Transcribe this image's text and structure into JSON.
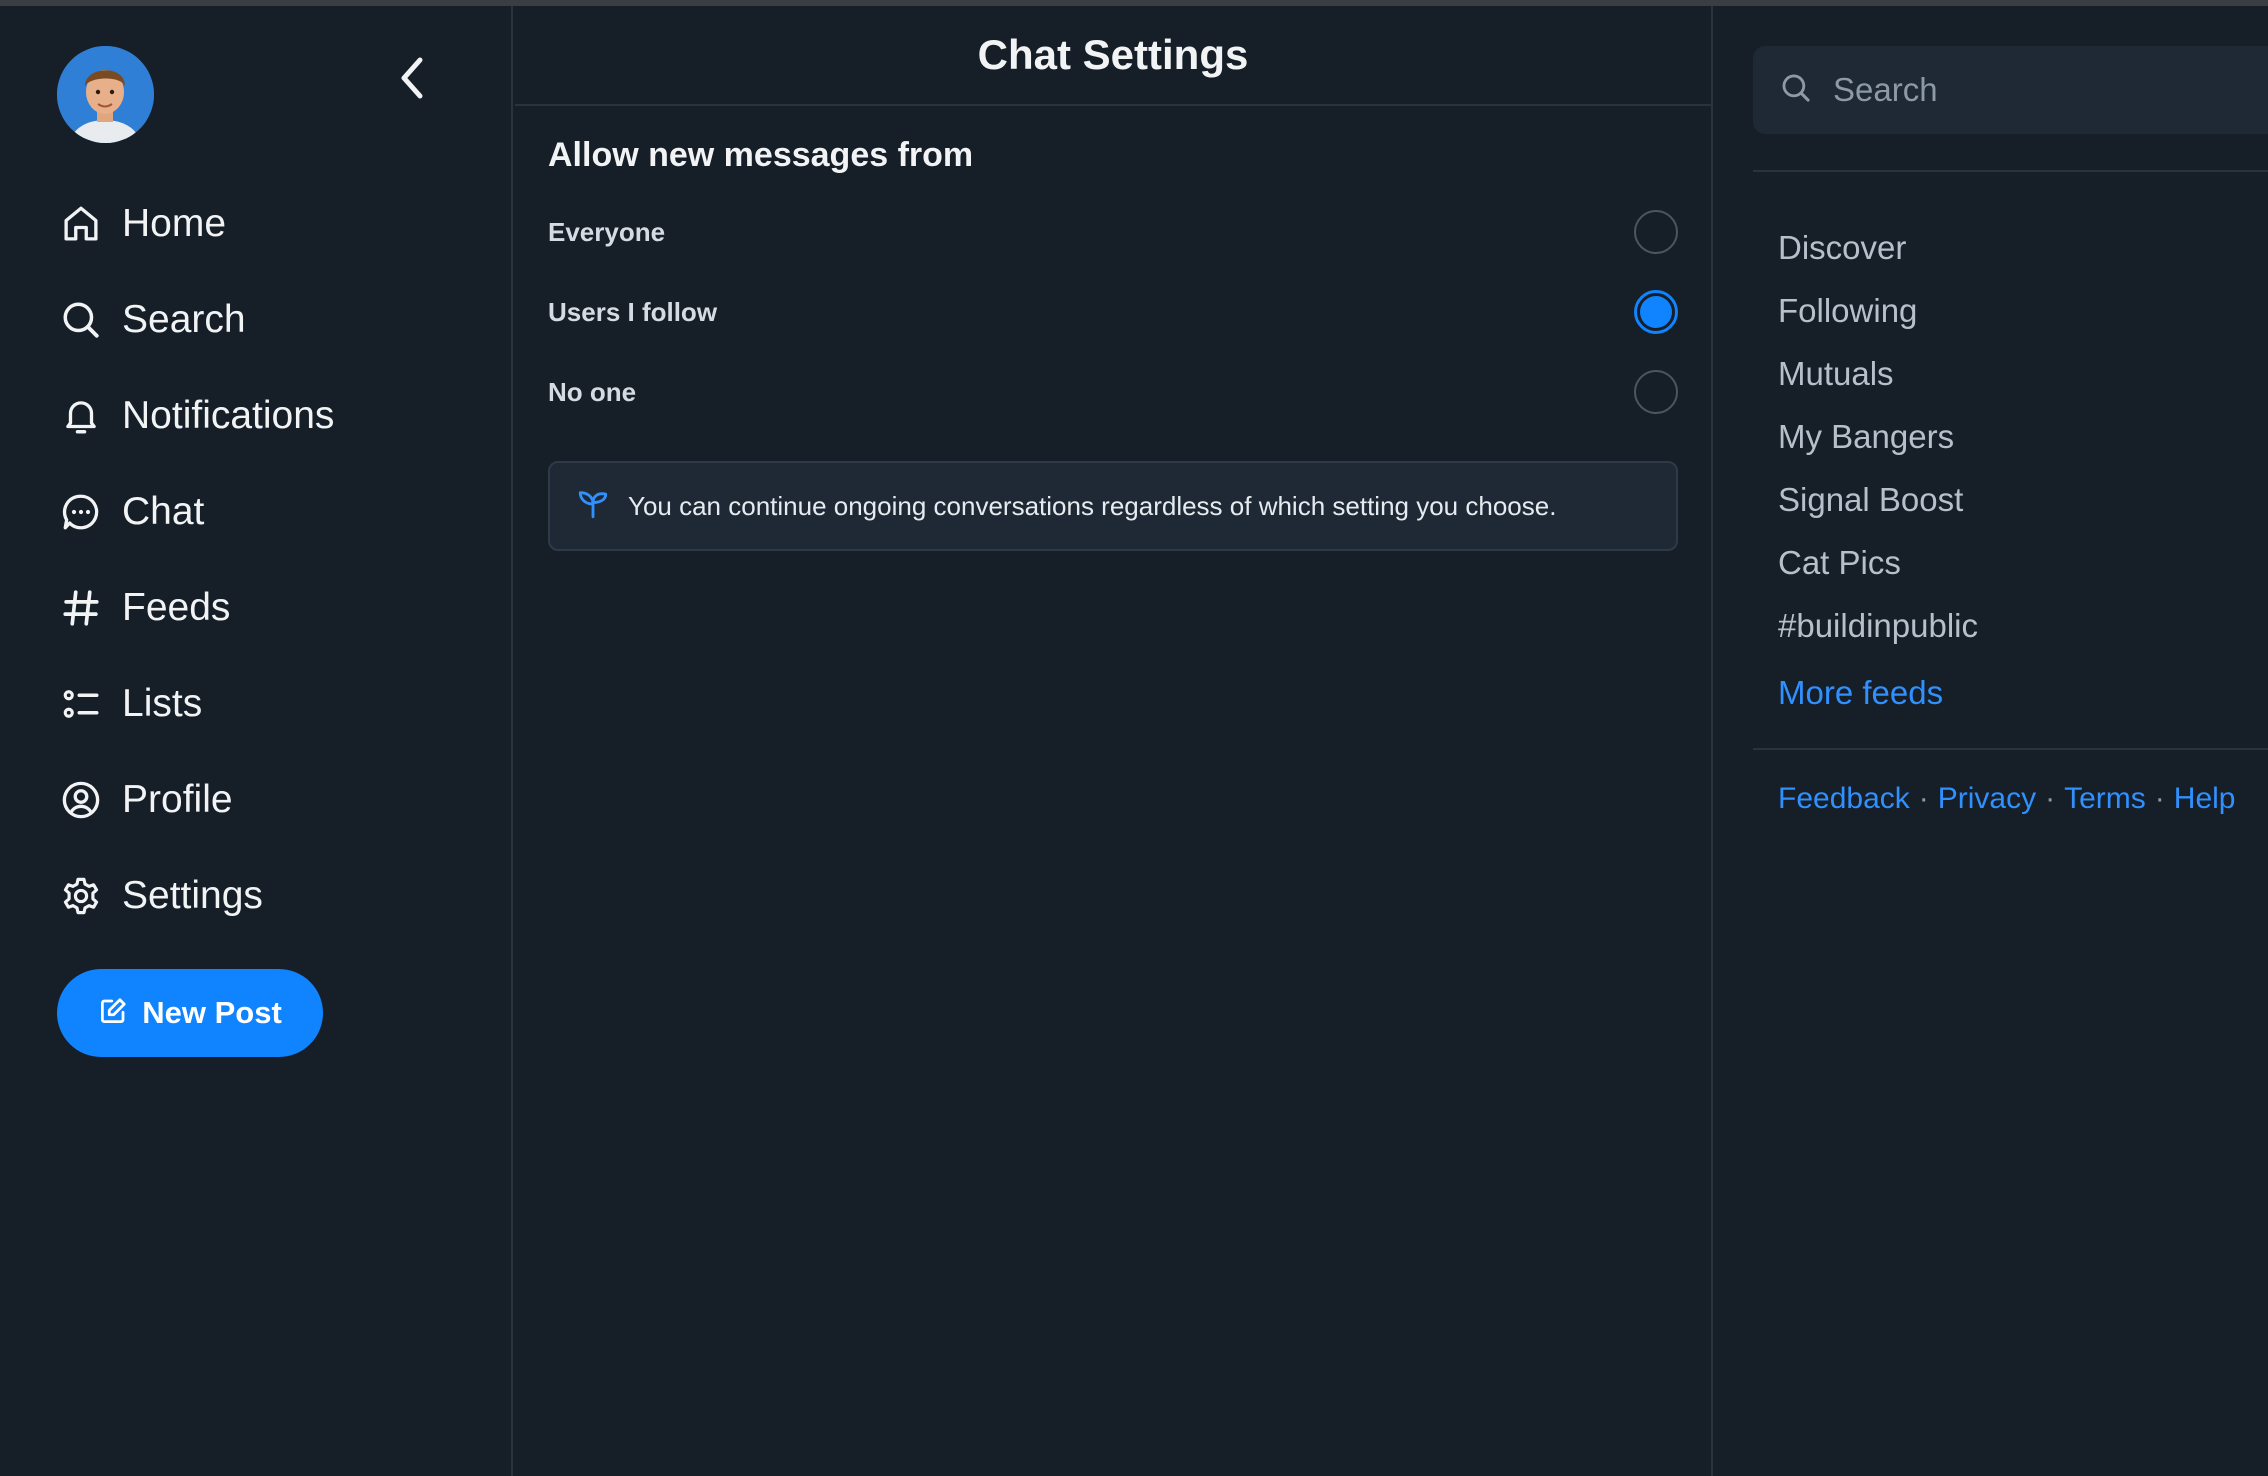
{
  "sidebar": {
    "back_label": "",
    "nav": [
      {
        "label": "Home",
        "icon": "home-icon"
      },
      {
        "label": "Search",
        "icon": "search-icon"
      },
      {
        "label": "Notifications",
        "icon": "bell-icon"
      },
      {
        "label": "Chat",
        "icon": "chat-icon"
      },
      {
        "label": "Feeds",
        "icon": "hash-icon"
      },
      {
        "label": "Lists",
        "icon": "list-icon"
      },
      {
        "label": "Profile",
        "icon": "user-circle-icon"
      },
      {
        "label": "Settings",
        "icon": "gear-icon"
      }
    ],
    "new_post_label": "New Post"
  },
  "main": {
    "title": "Chat Settings",
    "section_title": "Allow new messages from",
    "options": [
      {
        "label": "Everyone",
        "checked": false
      },
      {
        "label": "Users I follow",
        "checked": true
      },
      {
        "label": "No one",
        "checked": false
      }
    ],
    "info_text": "You can continue ongoing conversations regardless of which setting you choose."
  },
  "right": {
    "search_placeholder": "Search",
    "feeds": [
      "Discover",
      "Following",
      "Mutuals",
      "My Bangers",
      "Signal Boost",
      "Cat Pics",
      "#buildinpublic"
    ],
    "more_feeds_label": "More feeds",
    "footer_links": [
      "Feedback",
      "Privacy",
      "Terms",
      "Help"
    ]
  },
  "colors": {
    "background": "#161e27",
    "accent": "#1083fe",
    "link": "#2f90fe",
    "muted_text": "#b6c0cb"
  }
}
